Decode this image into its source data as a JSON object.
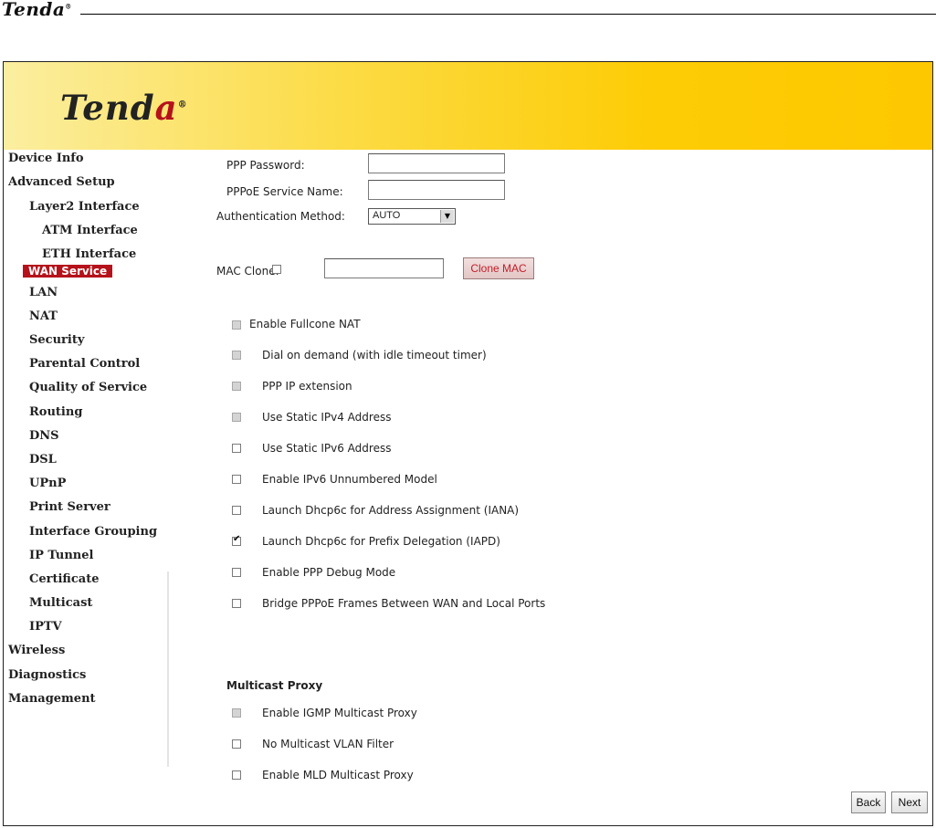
{
  "doc_header": {
    "logo": "Tenda"
  },
  "banner": {
    "logo_main": "Tend",
    "logo_accent": "a"
  },
  "sidebar": {
    "items": [
      {
        "label": "Device Info"
      },
      {
        "label": "Advanced Setup"
      },
      {
        "label": "Layer2 Interface"
      },
      {
        "label": "ATM Interface"
      },
      {
        "label": "ETH Interface"
      },
      {
        "label": "WAN Service",
        "active": true
      },
      {
        "label": "LAN"
      },
      {
        "label": "NAT"
      },
      {
        "label": "Security"
      },
      {
        "label": "Parental Control"
      },
      {
        "label": "Quality of Service"
      },
      {
        "label": "Routing"
      },
      {
        "label": "DNS"
      },
      {
        "label": "DSL"
      },
      {
        "label": "UPnP"
      },
      {
        "label": "Print Server"
      },
      {
        "label": "Interface Grouping"
      },
      {
        "label": "IP Tunnel"
      },
      {
        "label": "Certificate"
      },
      {
        "label": "Multicast"
      },
      {
        "label": "IPTV"
      },
      {
        "label": "Wireless"
      },
      {
        "label": "Diagnostics"
      },
      {
        "label": "Management"
      }
    ]
  },
  "form": {
    "ppp_password_label": "PPP Password:",
    "ppp_password_value": "",
    "pppoe_service_label": "PPPoE Service Name:",
    "pppoe_service_value": "",
    "auth_label": "Authentication Method:",
    "auth_value": "AUTO",
    "mac_clone_label": "MAC Clone:",
    "mac_clone_checked": false,
    "mac_value": "",
    "clone_button": "Clone MAC",
    "options": [
      {
        "label": "Enable Fullcone NAT",
        "checked": false,
        "disabled": true
      },
      {
        "label": "Dial on demand (with idle timeout timer)",
        "checked": false,
        "disabled": true
      },
      {
        "label": "PPP IP extension",
        "checked": false,
        "disabled": true
      },
      {
        "label": "Use Static IPv4 Address",
        "checked": false,
        "disabled": true
      },
      {
        "label": "Use Static IPv6 Address",
        "checked": false,
        "disabled": false
      },
      {
        "label": "Enable IPv6 Unnumbered Model",
        "checked": false,
        "disabled": false
      },
      {
        "label": "Launch Dhcp6c for Address Assignment (IANA)",
        "checked": false,
        "disabled": false
      },
      {
        "label": "Launch Dhcp6c for Prefix Delegation (IAPD)",
        "checked": true,
        "disabled": false
      },
      {
        "label": "Enable PPP Debug Mode",
        "checked": false,
        "disabled": false
      },
      {
        "label": "Bridge PPPoE Frames Between WAN and Local Ports",
        "checked": false,
        "disabled": false
      }
    ],
    "multicast_title": "Multicast Proxy",
    "multicast_options": [
      {
        "label": "Enable IGMP Multicast Proxy",
        "checked": false,
        "disabled": true
      },
      {
        "label": "No Multicast VLAN Filter",
        "checked": false,
        "disabled": false
      },
      {
        "label": "Enable MLD Multicast Proxy",
        "checked": false,
        "disabled": false
      }
    ],
    "back_button": "Back",
    "next_button": "Next"
  }
}
